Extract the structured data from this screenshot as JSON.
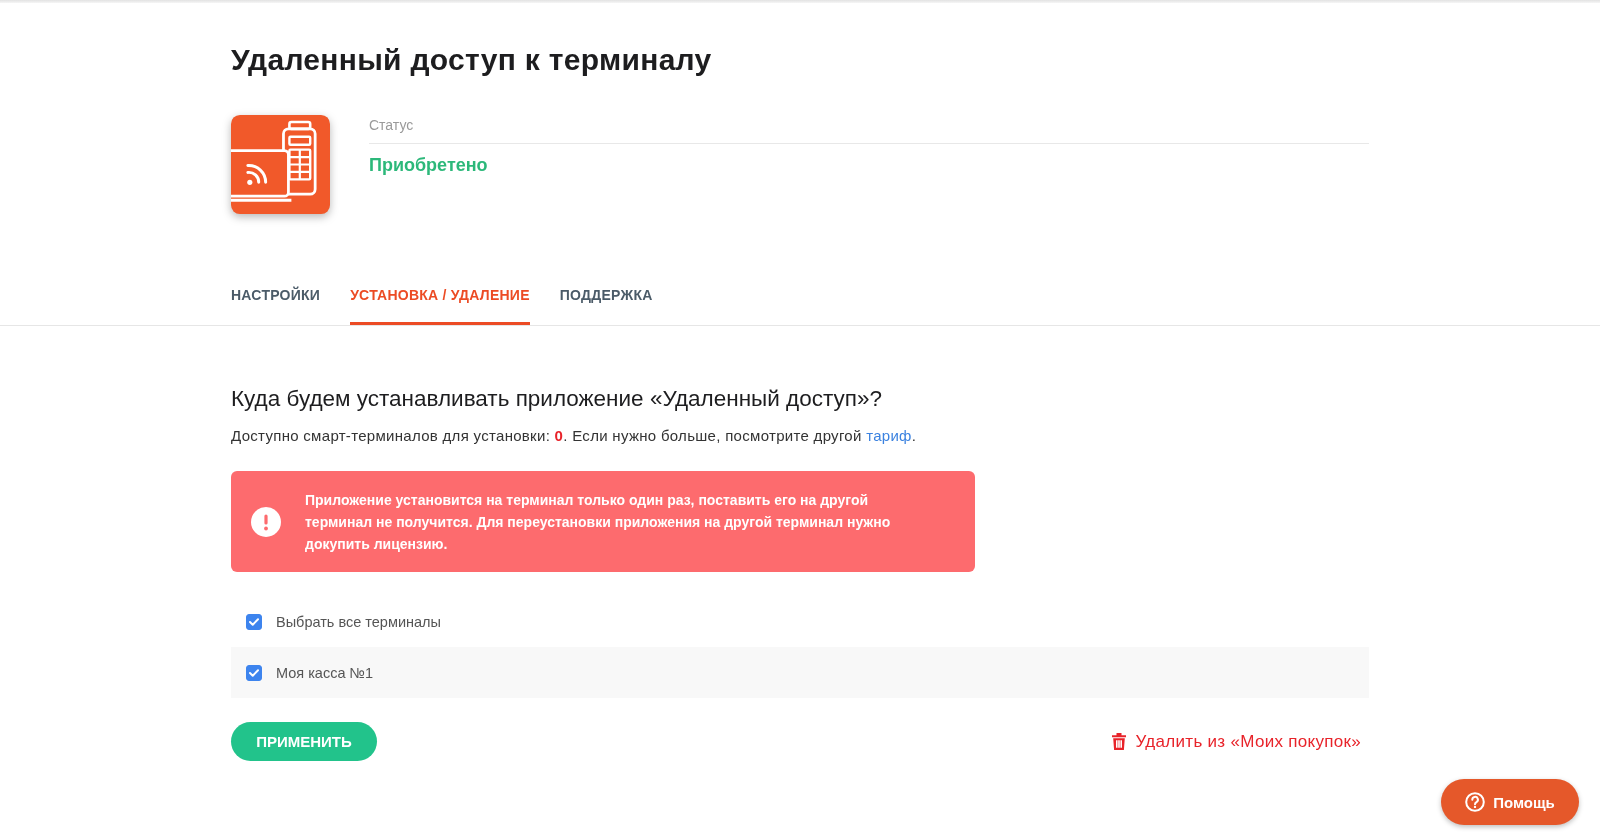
{
  "page": {
    "title": "Удаленный доступ к терминалу"
  },
  "app": {
    "status_label": "Статус",
    "status": "Приобретено"
  },
  "tabs": [
    {
      "label": "НАСТРОЙКИ",
      "selected": false
    },
    {
      "label": "УСТАНОВКА / УДАЛЕНИЕ",
      "selected": true
    },
    {
      "label": "ПОДДЕРЖКА",
      "selected": false
    }
  ],
  "install": {
    "heading": "Куда будем устанавливать приложение «Удаленный доступ»?",
    "availability": {
      "text": "Доступно смарт-терминалов для установки: **0**. Если нужно больше, посмотрите другой",
      "link": "тариф",
      "text_after": "."
    },
    "alert": {
      "text": "Приложение установится на терминал только один раз, поставить его на другой терминал не получится. Для переустановки приложения на другой терминал нужно докупить лицензию."
    },
    "select_all": {
      "label": "Выбрать все терминалы",
      "checked": true
    },
    "terminals": [
      {
        "label": "Моя касса №1",
        "checked": true
      }
    ],
    "apply_button": "ПРИМЕНИТЬ",
    "delete_link": "Удалить из «Моих покупок»"
  },
  "help_button": "Помощь"
}
